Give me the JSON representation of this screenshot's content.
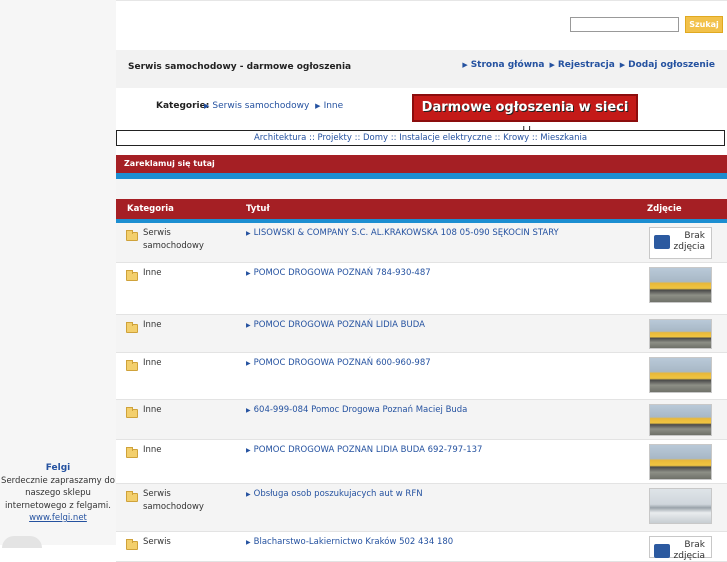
{
  "sidebar": {
    "ad_title": "Felgi",
    "ad_text": "Serdecznie zapraszamy do naszego sklepu internetowego z felgami.",
    "ad_link": "www.felgi.net"
  },
  "search": {
    "placeholder": "",
    "button": "Szukaj"
  },
  "header": {
    "site_title": "Serwis samochodowy - darmowe ogłoszenia",
    "nav": [
      "Strona główna",
      "Rejestracja",
      "Dodaj ogłoszenie"
    ]
  },
  "categories": {
    "label": "Kategorie:",
    "crumbs": [
      "Serwis samochodowy",
      "Inne"
    ],
    "banner": "Darmowe ogłoszenia w sieci !!"
  },
  "links_bar": "Architektura :: Projekty :: Domy :: Instalacje elektryczne :: Krowy :: Mieszkania",
  "ad_strip": "Zareklamuj się tutaj",
  "table": {
    "headers": [
      "Kategoria",
      "Tytuł",
      "Zdjęcie"
    ],
    "no_photo": [
      "Brak",
      "zdjęcia"
    ],
    "rows": [
      {
        "cat": "Serwis samochodowy",
        "title": "LISOWSKI & COMPANY S.C. AL.KRAKOWSKA 108 05-090 SĘKOCIN STARY",
        "photo": "none"
      },
      {
        "cat": "Inne",
        "title": "POMOC DROGOWA POZNAŃ 784-930-487",
        "photo": "tow-truck"
      },
      {
        "cat": "Inne",
        "title": "POMOC DROGOWA POZNAŃ LIDIA BUDA",
        "photo": "tow-truck"
      },
      {
        "cat": "Inne",
        "title": "POMOC DROGOWA POZNAŃ 600-960-987",
        "photo": "tow-truck"
      },
      {
        "cat": "Inne",
        "title": "604-999-084 Pomoc Drogowa Poznań Maciej Buda",
        "photo": "tow-truck"
      },
      {
        "cat": "Inne",
        "title": "POMOC DROGOWA POZNAN LIDIA BUDA 692-797-137",
        "photo": "tow-truck"
      },
      {
        "cat": "Serwis samochodowy",
        "title": "Obsługa osob poszukujacych aut w RFN",
        "photo": "car"
      },
      {
        "cat": "Serwis",
        "title": "Blacharstwo-Lakiernictwo Kraków 502 434 180",
        "photo": "none"
      }
    ]
  }
}
